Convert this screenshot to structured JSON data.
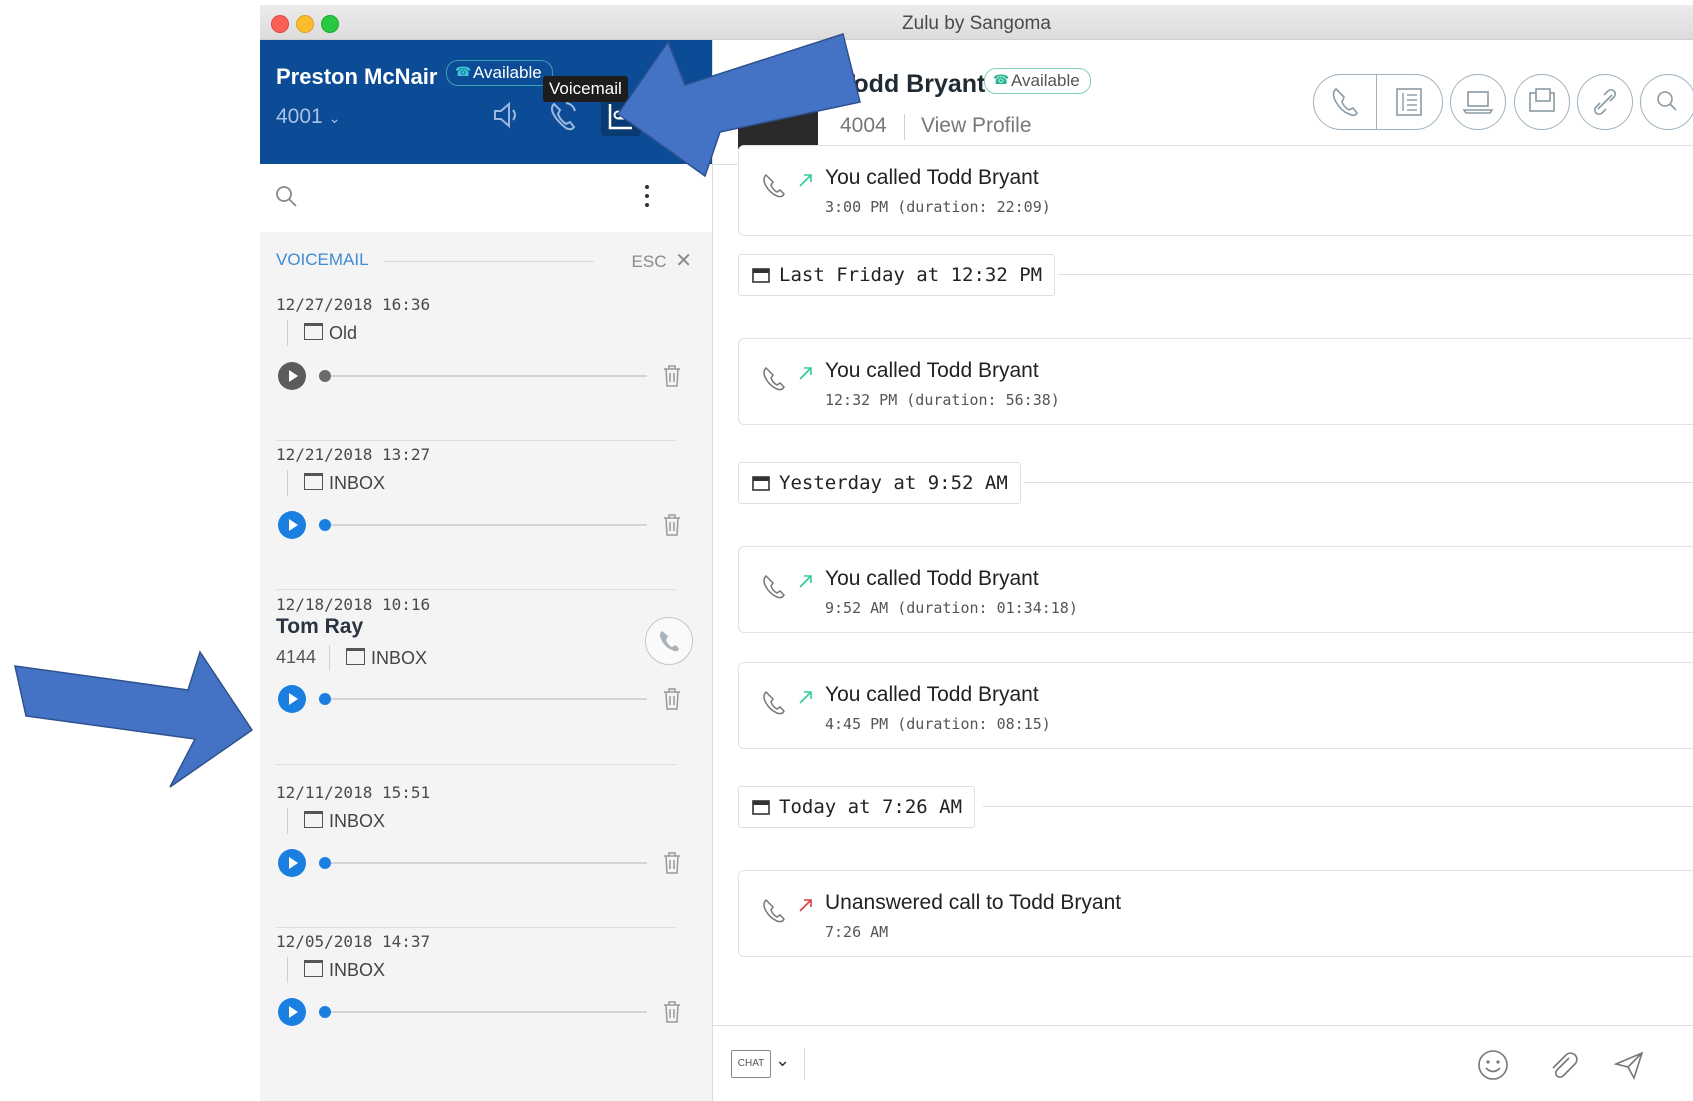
{
  "window": {
    "title": "Zulu by Sangoma"
  },
  "user": {
    "name": "Preston McNair",
    "status": "Available",
    "extension": "4001"
  },
  "tooltip": {
    "text": "Voicemail"
  },
  "voicemail": {
    "header": "VOICEMAIL",
    "esc_label": "ESC",
    "items": [
      {
        "timestamp": "12/27/2018 16:36",
        "folder": "Old"
      },
      {
        "timestamp": "12/21/2018 13:27",
        "folder": "INBOX"
      },
      {
        "timestamp": "12/18/2018 10:16",
        "caller_name": "Tom Ray",
        "caller_ext": "4144",
        "folder": "INBOX"
      },
      {
        "timestamp": "12/11/2018 15:51",
        "folder": "INBOX"
      },
      {
        "timestamp": "12/05/2018 14:37",
        "folder": "INBOX"
      }
    ]
  },
  "contact": {
    "name": "Todd Bryant",
    "status": "Available",
    "extension": "4004",
    "view_profile": "View Profile"
  },
  "feed": {
    "card0": {
      "title": "You called Todd Bryant",
      "detail": "3:00 PM (duration: 22:09)"
    },
    "date1": "Last Friday at 12:32 PM",
    "card1": {
      "title": "You called Todd Bryant",
      "detail": "12:32 PM (duration: 56:38)"
    },
    "date2": "Yesterday at 9:52 AM",
    "card2": {
      "title": "You called Todd Bryant",
      "detail": "9:52 AM (duration: 01:34:18)"
    },
    "card3": {
      "title": "You called Todd Bryant",
      "detail": "4:45 PM (duration: 08:15)"
    },
    "date3": "Today at 7:26 AM",
    "card4": {
      "title": "Unanswered call to Todd Bryant",
      "detail": "7:26 AM"
    }
  },
  "composer": {
    "mode_label": "CHAT"
  },
  "colors": {
    "header_blue": "#0c4b96",
    "accent_blue": "#1a7fe0",
    "outgoing_green": "#2ecc9a",
    "missed_red": "#e23b3b",
    "annotation_arrow": "#4472c4"
  }
}
